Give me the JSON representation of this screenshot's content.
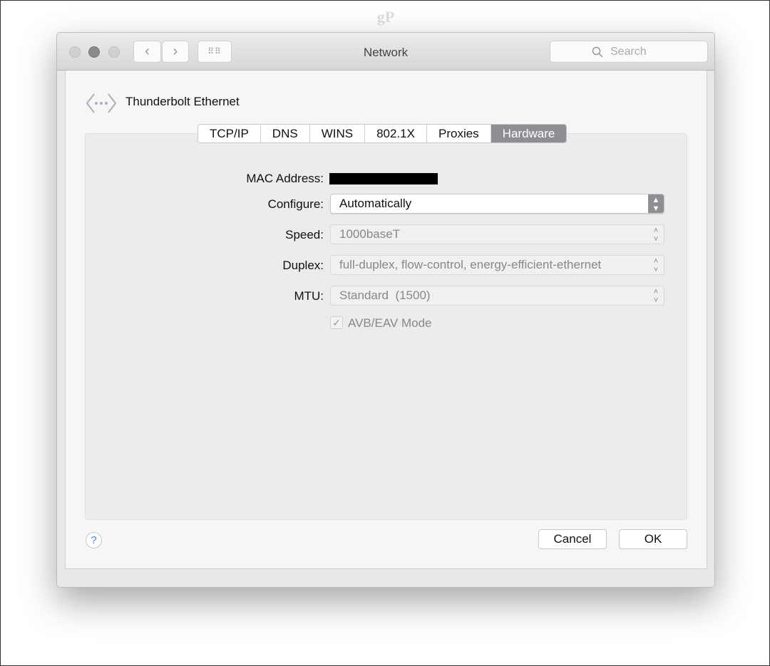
{
  "watermark": "gP",
  "window": {
    "title": "Network",
    "search_placeholder": "Search"
  },
  "header": {
    "interface": "Thunderbolt Ethernet"
  },
  "tabs": [
    {
      "label": "TCP/IP"
    },
    {
      "label": "DNS"
    },
    {
      "label": "WINS"
    },
    {
      "label": "802.1X"
    },
    {
      "label": "Proxies"
    },
    {
      "label": "Hardware",
      "selected": true
    }
  ],
  "hardware": {
    "mac_label": "MAC Address:",
    "configure_label": "Configure:",
    "configure_value": "Automatically",
    "speed_label": "Speed:",
    "speed_value": "1000baseT",
    "duplex_label": "Duplex:",
    "duplex_value": "full-duplex, flow-control, energy-efficient-ethernet",
    "mtu_label": "MTU:",
    "mtu_value": "Standard  (1500)",
    "avb_label": "AVB/EAV Mode",
    "avb_checked": true
  },
  "buttons": {
    "help": "?",
    "cancel": "Cancel",
    "ok": "OK"
  }
}
